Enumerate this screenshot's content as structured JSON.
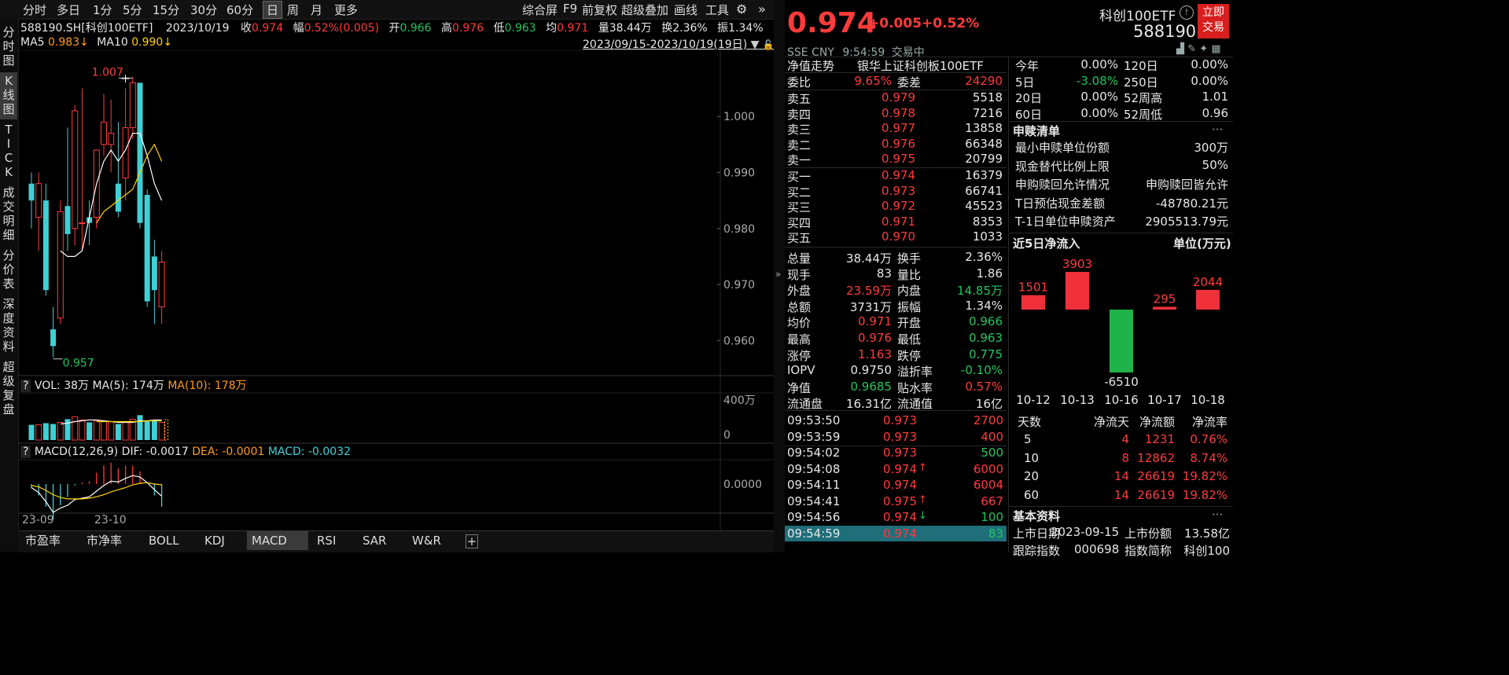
{
  "toolbar": {
    "periods": [
      "分时",
      "多日",
      "1分",
      "5分",
      "15分",
      "30分",
      "60分",
      "日",
      "周",
      "月",
      "更多"
    ],
    "active_period": "日",
    "right_items": [
      "综合屏",
      "F9",
      "前复权",
      "超级叠加",
      "画线",
      "工具"
    ],
    "gear_icon": "gear-icon",
    "expand_icon": "double-chevron-right-icon"
  },
  "left_tabs": [
    {
      "label": "分时图",
      "active": false
    },
    {
      "label": "K线图",
      "active": true
    },
    {
      "label": "TICK",
      "active": false
    },
    {
      "label": "成交明细",
      "active": false
    },
    {
      "label": "分价表",
      "active": false
    },
    {
      "label": "深度资料",
      "active": false
    },
    {
      "label": "超级复盘",
      "active": false
    }
  ],
  "info_line": {
    "code_name": "588190.SH[科创100ETF]",
    "date": "2023/10/19",
    "close_label": "收",
    "close": "0.974",
    "amp_label": "幅",
    "amp": "0.52%(0.005)",
    "open_label": "开",
    "open": "0.966",
    "high_label": "高",
    "high": "0.976",
    "low_label": "低",
    "low": "0.963",
    "avg_label": "均",
    "avg": "0.971",
    "vol_label": "量",
    "vol": "38.44万",
    "turn_label": "换",
    "turn": "2.36%",
    "swing_label": "振",
    "swing": "1.34%"
  },
  "ma_line": {
    "ma5_label": "MA5",
    "ma5": "0.983↓",
    "ma10_label": "MA10",
    "ma10": "0.990↓",
    "range": "2023/09/15-2023/10/19(19日)"
  },
  "price_axis": [
    "1.000",
    "0.990",
    "0.980",
    "0.970",
    "0.960"
  ],
  "kline_markers": {
    "high": "1.007",
    "low": "0.957"
  },
  "chart_data": {
    "type": "candlestick",
    "candles": [
      {
        "o": 0.988,
        "h": 0.99,
        "c": 0.985,
        "l": 0.98
      },
      {
        "o": 0.982,
        "h": 0.99,
        "c": 0.988,
        "l": 0.976
      },
      {
        "o": 0.985,
        "h": 0.988,
        "c": 0.969,
        "l": 0.968
      },
      {
        "o": 0.962,
        "h": 0.966,
        "c": 0.959,
        "l": 0.957
      },
      {
        "o": 0.964,
        "h": 0.985,
        "c": 0.983,
        "l": 0.963
      },
      {
        "o": 0.984,
        "h": 0.998,
        "c": 0.979,
        "l": 0.976
      },
      {
        "o": 0.98,
        "h": 1.002,
        "c": 1.001,
        "l": 0.977
      },
      {
        "o": 0.981,
        "h": 1.005,
        "c": 0.981,
        "l": 0.976
      },
      {
        "o": 0.982,
        "h": 0.985,
        "c": 0.981,
        "l": 0.977
      },
      {
        "o": 0.982,
        "h": 0.994,
        "c": 0.994,
        "l": 0.98
      },
      {
        "o": 0.995,
        "h": 1.004,
        "c": 0.999,
        "l": 0.993
      },
      {
        "o": 0.995,
        "h": 1.003,
        "c": 0.997,
        "l": 0.99
      },
      {
        "o": 0.988,
        "h": 0.999,
        "c": 0.983,
        "l": 0.982
      },
      {
        "o": 0.989,
        "h": 1.005,
        "c": 0.998,
        "l": 0.985
      },
      {
        "o": 0.998,
        "h": 1.007,
        "c": 1.006,
        "l": 0.996
      },
      {
        "o": 1.006,
        "h": 1.006,
        "c": 0.981,
        "l": 0.98
      },
      {
        "o": 0.986,
        "h": 0.987,
        "c": 0.967,
        "l": 0.966
      },
      {
        "o": 0.975,
        "h": 0.978,
        "c": 0.969,
        "l": 0.963
      },
      {
        "o": 0.966,
        "h": 0.976,
        "c": 0.974,
        "l": 0.963
      }
    ],
    "ma5": [
      null,
      null,
      null,
      null,
      0.976,
      0.975,
      0.975,
      0.976,
      0.982,
      0.988,
      0.992,
      0.994,
      0.992,
      0.994,
      0.997,
      0.997,
      0.993,
      0.988,
      0.985
    ],
    "ma10": [
      null,
      null,
      null,
      null,
      null,
      null,
      null,
      null,
      null,
      0.981,
      0.983,
      0.984,
      0.985,
      0.986,
      0.987,
      0.99,
      0.993,
      0.995,
      0.992
    ],
    "volume": [
      19,
      19,
      21,
      20,
      22,
      26,
      29,
      25,
      22,
      24,
      23,
      23,
      20,
      22,
      26,
      31,
      24,
      25,
      22
    ],
    "vol_ma5": [
      null,
      null,
      null,
      null,
      20,
      21,
      23,
      24,
      25,
      25,
      24,
      23,
      22,
      22,
      22,
      24,
      24,
      25,
      25
    ],
    "vol_ma10": [
      null,
      null,
      null,
      null,
      null,
      null,
      null,
      null,
      null,
      23,
      23,
      23,
      23,
      23,
      23,
      23,
      24,
      24,
      24
    ],
    "macd_dif": [
      -0.0005,
      -0.0012,
      -0.0025,
      -0.004,
      -0.0034,
      -0.003,
      -0.0022,
      -0.002,
      -0.0018,
      -0.001,
      -0.0002,
      0.0004,
      0.0003,
      0.0008,
      0.0012,
      0.001,
      0.0002,
      -0.0008,
      -0.0017
    ],
    "macd_dea": [
      -0.0002,
      -0.0004,
      -0.0009,
      -0.0015,
      -0.0019,
      -0.0021,
      -0.0021,
      -0.0021,
      -0.002,
      -0.0018,
      -0.0015,
      -0.0011,
      -0.0008,
      -0.0005,
      -0.0001,
      0.0001,
      0.0002,
      0.0,
      -0.0001
    ],
    "xlabels": [
      "23-09",
      "23-10"
    ],
    "ylim": [
      0.955,
      1.009
    ]
  },
  "vol_legend": {
    "q": "?",
    "vol": "VOL: 38万",
    "ma5": "MA(5): 174万",
    "ma10": "MA(10): 178万"
  },
  "vol_axis": [
    "400万",
    "0"
  ],
  "macd_legend": {
    "q": "?",
    "title": "MACD(12,26,9)",
    "dif": "DIF: -0.0017",
    "dea": "DEA: -0.0001",
    "macd": "MACD: -0.0032"
  },
  "macd_axis": [
    "0.0000"
  ],
  "bottom_tabs": [
    "市盈率",
    "市净率",
    "BOLL",
    "KDJ",
    "MACD",
    "RSI",
    "SAR",
    "W&R"
  ],
  "active_bottom_tab": "MACD",
  "add_tab": "+",
  "quote": {
    "price": "0.974",
    "change": "+0.005",
    "pct": "+0.52%",
    "name": "科创100ETF",
    "code": "588190",
    "trade_btn": "立即\n交易",
    "exchange": "SSE",
    "currency": "CNY",
    "time": "9:54:59",
    "status": "交易中"
  },
  "nav_title": {
    "label": "净值走势",
    "fund": "银华上证科创板100ETF"
  },
  "committee": {
    "ratio_label": "委比",
    "ratio": "9.65%",
    "diff_label": "委差",
    "diff": "24290"
  },
  "asks": [
    {
      "label": "卖五",
      "price": "0.979",
      "vol": "5518"
    },
    {
      "label": "卖四",
      "price": "0.978",
      "vol": "7216"
    },
    {
      "label": "卖三",
      "price": "0.977",
      "vol": "13858"
    },
    {
      "label": "卖二",
      "price": "0.976",
      "vol": "66348"
    },
    {
      "label": "卖一",
      "price": "0.975",
      "vol": "20799"
    }
  ],
  "bids": [
    {
      "label": "买一",
      "price": "0.974",
      "vol": "16379"
    },
    {
      "label": "买二",
      "price": "0.973",
      "vol": "66741"
    },
    {
      "label": "买三",
      "price": "0.972",
      "vol": "45523"
    },
    {
      "label": "买四",
      "price": "0.971",
      "vol": "8353"
    },
    {
      "label": "买五",
      "price": "0.970",
      "vol": "1033"
    }
  ],
  "stats": [
    {
      "l1": "总量",
      "v1": "38.44万",
      "c1": "white",
      "l2": "换手",
      "v2": "2.36%",
      "c2": "white"
    },
    {
      "l1": "现手",
      "v1": "83",
      "c1": "white",
      "l2": "量比",
      "v2": "1.86",
      "c2": "white"
    },
    {
      "l1": "外盘",
      "v1": "23.59万",
      "c1": "red",
      "l2": "内盘",
      "v2": "14.85万",
      "c2": "green"
    },
    {
      "l1": "总额",
      "v1": "3731万",
      "c1": "white",
      "l2": "振幅",
      "v2": "1.34%",
      "c2": "white"
    },
    {
      "l1": "均价",
      "v1": "0.971",
      "c1": "red",
      "l2": "开盘",
      "v2": "0.966",
      "c2": "green"
    },
    {
      "l1": "最高",
      "v1": "0.976",
      "c1": "red",
      "l2": "最低",
      "v2": "0.963",
      "c2": "green"
    },
    {
      "l1": "涨停",
      "v1": "1.163",
      "c1": "red",
      "l2": "跌停",
      "v2": "0.775",
      "c2": "green"
    },
    {
      "l1": "IOPV",
      "v1": "0.9750",
      "c1": "white",
      "l2": "溢折率",
      "v2": "-0.10%",
      "c2": "green"
    },
    {
      "l1": "净值",
      "v1": "0.9685",
      "c1": "green",
      "l2": "贴水率",
      "v2": "0.57%",
      "c2": "red"
    },
    {
      "l1": "流通盘",
      "v1": "16.31亿",
      "c1": "white",
      "l2": "流通值",
      "v2": "16亿",
      "c2": "white"
    }
  ],
  "ticks": [
    {
      "time": "09:53:50",
      "price": "0.973",
      "vol": "2700",
      "vc": "red",
      "arrow": ""
    },
    {
      "time": "09:53:59",
      "price": "0.973",
      "vol": "400",
      "vc": "red",
      "arrow": ""
    },
    {
      "time": "09:54:02",
      "price": "0.973",
      "vol": "500",
      "vc": "green",
      "arrow": ""
    },
    {
      "time": "09:54:08",
      "price": "0.974",
      "vol": "6000",
      "vc": "red",
      "arrow": "↑"
    },
    {
      "time": "09:54:11",
      "price": "0.974",
      "vol": "6004",
      "vc": "red",
      "arrow": ""
    },
    {
      "time": "09:54:41",
      "price": "0.975",
      "vol": "667",
      "vc": "red",
      "arrow": "↑"
    },
    {
      "time": "09:54:56",
      "price": "0.974",
      "vol": "100",
      "vc": "green",
      "arrow": "↓"
    },
    {
      "time": "09:54:59",
      "price": "0.974",
      "vol": "83",
      "vc": "green",
      "arrow": ""
    }
  ],
  "perf": [
    {
      "l1": "今年",
      "v1": "0.00%",
      "c1": "white",
      "l2": "120日",
      "v2": "0.00%"
    },
    {
      "l1": "5日",
      "v1": "-3.08%",
      "c1": "green",
      "l2": "250日",
      "v2": "0.00%"
    },
    {
      "l1": "20日",
      "v1": "0.00%",
      "c1": "white",
      "l2": "52周高",
      "v2": "1.01"
    },
    {
      "l1": "60日",
      "v1": "0.00%",
      "c1": "white",
      "l2": "52周低",
      "v2": "0.96"
    }
  ],
  "subscribe": {
    "title": "申赎清单",
    "more": "···",
    "rows": [
      {
        "l": "最小申赎单位份额",
        "v": "300万"
      },
      {
        "l": "现金替代比例上限",
        "v": "50%"
      },
      {
        "l": "申购赎回允许情况",
        "v": "申购赎回皆允许"
      },
      {
        "l": "T日预估现金差额",
        "v": "-48780.21元"
      },
      {
        "l": "T-1日单位申赎资产",
        "v": "2905513.79元"
      }
    ]
  },
  "flow": {
    "title": "近5日净流入",
    "unit": "单位(万元)",
    "chart_data": {
      "type": "bar",
      "categories": [
        "10-12",
        "10-13",
        "10-16",
        "10-17",
        "10-18"
      ],
      "values": [
        1501,
        3903,
        -6510,
        295,
        2044
      ]
    }
  },
  "flow_table": {
    "headers": [
      "天数",
      "净流天",
      "净流额",
      "净流率"
    ],
    "rows": [
      [
        "5",
        "4",
        "1231",
        "0.76%"
      ],
      [
        "10",
        "8",
        "12862",
        "8.74%"
      ],
      [
        "20",
        "14",
        "26619",
        "19.82%"
      ],
      [
        "60",
        "14",
        "26619",
        "19.82%"
      ]
    ]
  },
  "basic": {
    "title": "基本资料",
    "more": "···",
    "row1": {
      "l1": "上市日期",
      "v1": "2023-09-15",
      "l2": "上市份额",
      "v2": "13.58亿"
    },
    "row2": {
      "l1": "跟踪指数",
      "v1": "000698",
      "l2": "指数简称",
      "v2": "科创100"
    }
  },
  "colors": {
    "up": "#ff3b3b",
    "down": "#3fd0d6",
    "ma5": "#ffffff",
    "ma10": "#ffd200",
    "green": "#22c55e",
    "bg": "#000000"
  }
}
